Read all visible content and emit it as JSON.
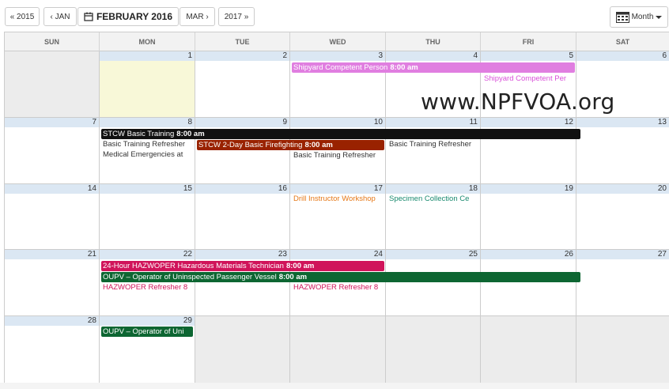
{
  "toolbar": {
    "prev_year": "« 2015",
    "prev_month": "‹ JAN",
    "current_month": "FEBRUARY 2016",
    "next_month": "MAR ›",
    "next_year": "2017 »",
    "view_label": "Month"
  },
  "days_of_week": [
    "SUN",
    "MON",
    "TUE",
    "WED",
    "THU",
    "FRI",
    "SAT"
  ],
  "weeks": [
    [
      "",
      "1",
      "2",
      "3",
      "4",
      "5",
      "6"
    ],
    [
      "7",
      "8",
      "9",
      "10",
      "11",
      "12",
      "13"
    ],
    [
      "14",
      "15",
      "16",
      "17",
      "18",
      "19",
      "20"
    ],
    [
      "21",
      "22",
      "23",
      "24",
      "25",
      "26",
      "27"
    ],
    [
      "28",
      "29",
      "",
      "",
      "",
      "",
      ""
    ]
  ],
  "events": {
    "shipyard_bar": {
      "title": "Shipyard Competent Person",
      "time": "8:00 am",
      "color": "#e07ee0"
    },
    "shipyard_text": {
      "title": "Shipyard Competent Per",
      "color": "#d950d9"
    },
    "stcw_basic": {
      "title": "STCW Basic Training",
      "time": "8:00 am",
      "color": "#111111"
    },
    "basic_refresher_1": {
      "title": "Basic Training Refresher"
    },
    "medical": {
      "title": "Medical Emergencies at"
    },
    "stcw_2day": {
      "title": "STCW 2-Day Basic Firefighting",
      "time": "8:00 am",
      "color": "#992200"
    },
    "basic_refresher_2": {
      "title": "Basic Training Refresher"
    },
    "basic_refresher_3": {
      "title": "Basic Training Refresher"
    },
    "drill_instructor": {
      "title": "Drill Instructor Workshop",
      "color": "#e67817"
    },
    "specimen": {
      "title": "Specimen Collection Ce",
      "color": "#1a8a6f"
    },
    "hazwoper_24": {
      "title": "24-Hour HAZWOPER Hazardous Materials Technician",
      "time": "8:00 am",
      "color": "#d0145a"
    },
    "oupv": {
      "title": "OUPV – Operator of Uninspected Passenger Vessel",
      "time": "8:00 am",
      "color": "#0d6632"
    },
    "hazwoper_ref_1": {
      "title": "HAZWOPER Refresher 8",
      "color": "#d0145a"
    },
    "hazwoper_ref_2": {
      "title": "HAZWOPER Refresher 8",
      "color": "#d0145a"
    },
    "oupv_short": {
      "title": "OUPV – Operator of Uni",
      "color": "#0d6632"
    }
  },
  "watermark": "www.NPFVOA.org"
}
